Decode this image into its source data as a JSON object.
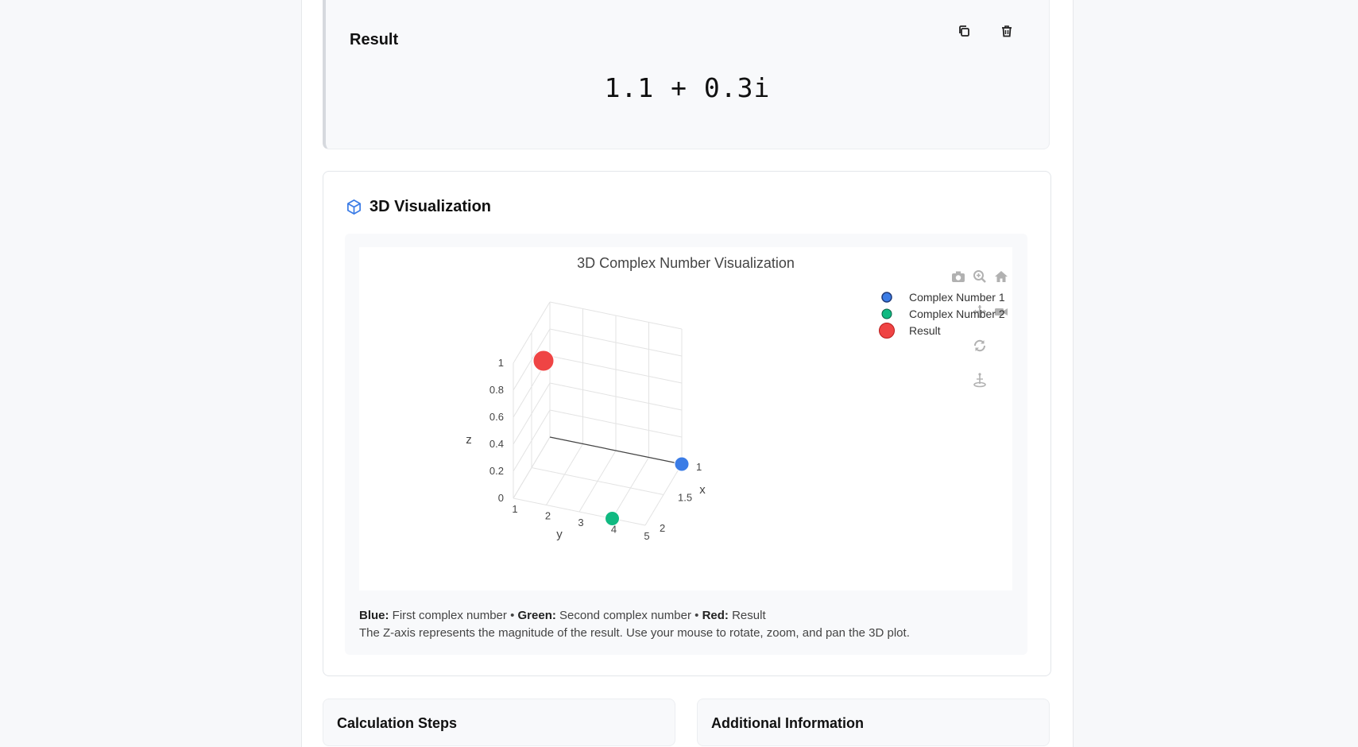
{
  "result": {
    "title": "Result",
    "value": "1.1 + 0.3i",
    "copy_icon": "copy-icon",
    "delete_icon": "trash-icon"
  },
  "visualization": {
    "title": "3D Visualization",
    "header_icon": "cube-icon",
    "plot_title": "3D Complex Number Visualization",
    "legend": [
      {
        "label": "Complex Number 1",
        "color": "#3b7ce6"
      },
      {
        "label": "Complex Number 2",
        "color": "#10b981"
      },
      {
        "label": "Result",
        "color": "#ef4444"
      }
    ],
    "axes": {
      "x_label": "x",
      "y_label": "y",
      "z_label": "z",
      "x_ticks": [
        "1",
        "1.5",
        "2"
      ],
      "y_ticks": [
        "1",
        "2",
        "3",
        "4",
        "5"
      ],
      "z_ticks": [
        "0",
        "0.2",
        "0.4",
        "0.6",
        "0.8",
        "1"
      ]
    },
    "modebar": [
      "camera-icon",
      "zoom-icon",
      "home-icon",
      "pan-icon",
      "orbit-camera-icon",
      "turntable-rotate-icon",
      "reset-axes-icon"
    ],
    "caption": {
      "blue_label": "Blue:",
      "blue_text": "First complex number",
      "sep": "•",
      "green_label": "Green:",
      "green_text": "Second complex number",
      "red_label": "Red:",
      "red_text": "Result",
      "line2": "The Z-axis represents the magnitude of the result. Use your mouse to rotate, zoom, and pan the 3D plot."
    }
  },
  "bottom": {
    "steps_title": "Calculation Steps",
    "info_title": "Additional Information"
  },
  "chart_data": {
    "type": "scatter",
    "title": "3D Complex Number Visualization",
    "xlabel": "x",
    "ylabel": "y",
    "zlabel": "z",
    "xlim": [
      1,
      2
    ],
    "ylim": [
      1,
      5
    ],
    "zlim": [
      0,
      1
    ],
    "series": [
      {
        "name": "Complex Number 1",
        "x": [
          1.0
        ],
        "y": [
          5.0
        ],
        "z": [
          0.0
        ]
      },
      {
        "name": "Complex Number 2",
        "x": [
          2.0
        ],
        "y": [
          4.0
        ],
        "z": [
          0.0
        ]
      },
      {
        "name": "Result",
        "x": [
          1.1
        ],
        "y": [
          0.3
        ],
        "z": [
          1.14
        ]
      }
    ],
    "legend": "top-right",
    "grid": true
  }
}
